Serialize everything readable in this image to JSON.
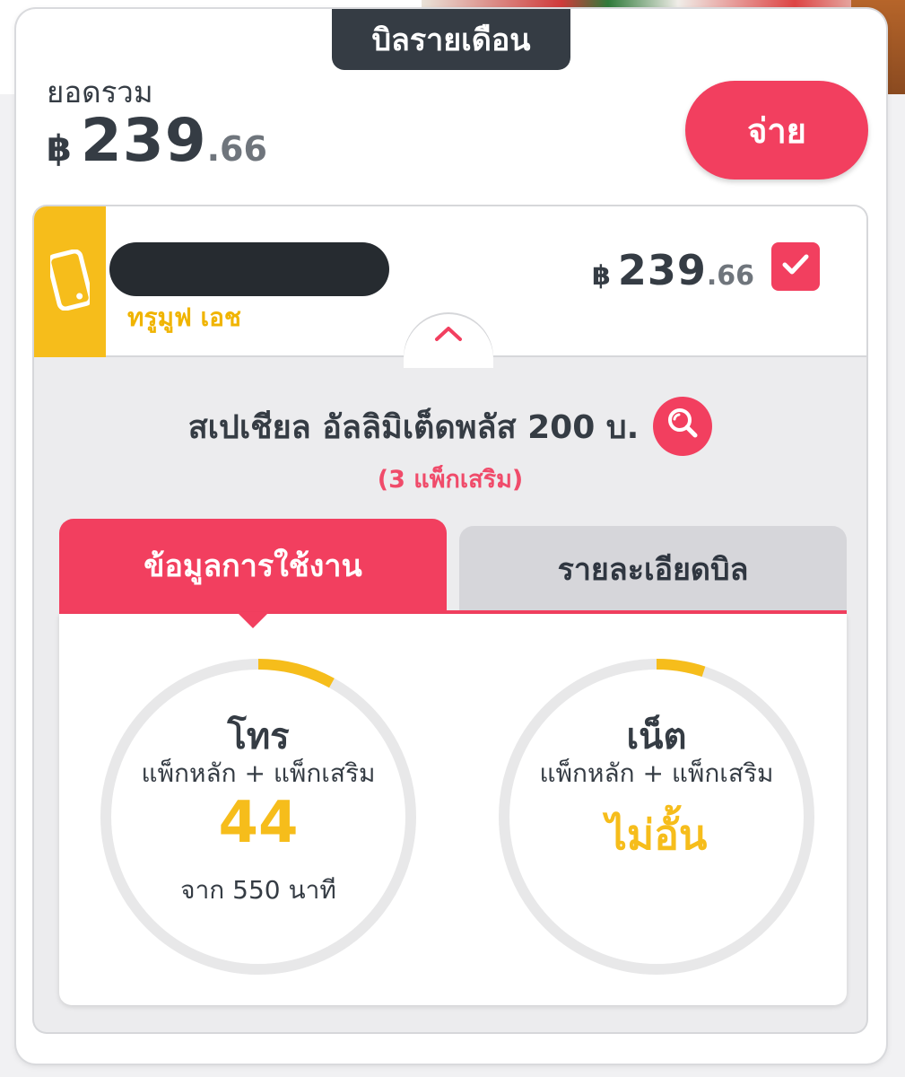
{
  "header": {
    "title": "บิลรายเดือน",
    "total_label": "ยอดรวม",
    "currency_symbol": "฿",
    "total_int": "239",
    "total_dec": ".66",
    "pay_label": "จ่าย"
  },
  "account": {
    "plan_name": "ทรูมูฟ เอช",
    "currency_symbol": "฿",
    "amount_int": "239",
    "amount_dec": ".66",
    "selected": true
  },
  "package": {
    "title": "สเปเชียล อัลลิมิเต็ดพลัส 200 บ.",
    "addons": "(3 แพ็กเสริม)"
  },
  "tabs": [
    {
      "label": "ข้อมูลการใช้งาน",
      "active": true
    },
    {
      "label": "รายละเอียดบิล",
      "active": false
    }
  ],
  "usage": {
    "call": {
      "title": "โทร",
      "subtitle": "แพ็กหลัก + แพ็กเสริม",
      "value": "44",
      "footer": "จาก 550 นาที",
      "fraction": 0.08
    },
    "net": {
      "title": "เน็ต",
      "subtitle": "แพ็กหลัก + แพ็กเสริม",
      "value": "ไม่อั้น",
      "fraction": 0.05
    }
  },
  "colors": {
    "accent": "#f23f5f",
    "highlight": "#f6bd1b",
    "dark": "#353c44"
  }
}
